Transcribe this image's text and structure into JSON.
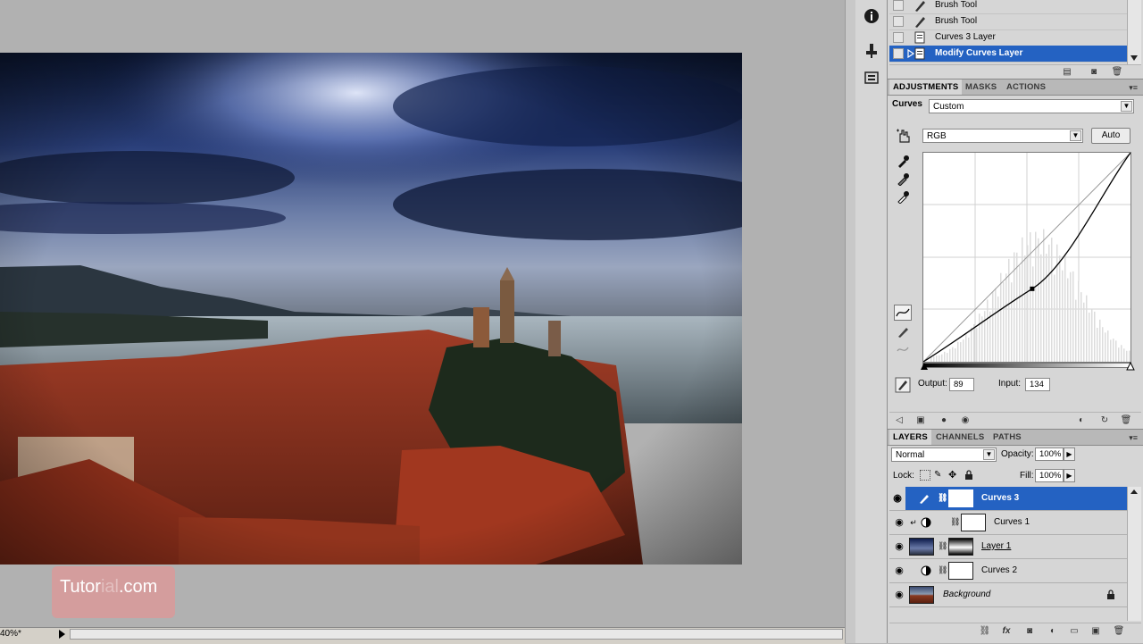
{
  "document": {
    "zoom": "40%*",
    "watermark_main": "Tutor",
    "watermark_faint": "ial",
    "watermark_tail": ".com"
  },
  "history": {
    "items": [
      {
        "label": "Brush Tool",
        "icon": "brush-icon"
      },
      {
        "label": "Brush Tool",
        "icon": "brush-icon"
      },
      {
        "label": "Curves 3 Layer",
        "icon": "layer-doc-icon"
      },
      {
        "label": "Modify Curves Layer",
        "icon": "layer-doc-icon",
        "selected": true
      }
    ]
  },
  "adjustments": {
    "tabs": [
      "ADJUSTMENTS",
      "MASKS",
      "ACTIONS"
    ],
    "active_tab": "ADJUSTMENTS",
    "title": "Curves",
    "preset": "Custom",
    "channel": "RGB",
    "auto_label": "Auto",
    "output_label": "Output:",
    "output_value": "89",
    "input_label": "Input:",
    "input_value": "134",
    "control_point": {
      "input": 134,
      "output": 89
    }
  },
  "layers": {
    "tabs": [
      "LAYERS",
      "CHANNELS",
      "PATHS"
    ],
    "active_tab": "LAYERS",
    "blend_mode": "Normal",
    "opacity_label": "Opacity:",
    "opacity_value": "100%",
    "lock_label": "Lock:",
    "fill_label": "Fill:",
    "fill_value": "100%",
    "items": [
      {
        "name": "Curves 3",
        "type": "adjustment",
        "selected": true,
        "italic": false
      },
      {
        "name": "Curves 1",
        "type": "adjustment",
        "selected": false,
        "italic": false
      },
      {
        "name": "Layer 1",
        "type": "pixel",
        "selected": false,
        "underline": true
      },
      {
        "name": "Curves 2",
        "type": "adjustment",
        "selected": false
      },
      {
        "name": "Background",
        "type": "background",
        "selected": false,
        "italic": true,
        "locked": true
      }
    ]
  },
  "colors": {
    "selection": "#2462c2",
    "panel_bg": "#d6d6d6",
    "canvas_bg": "#b1b1b1"
  }
}
